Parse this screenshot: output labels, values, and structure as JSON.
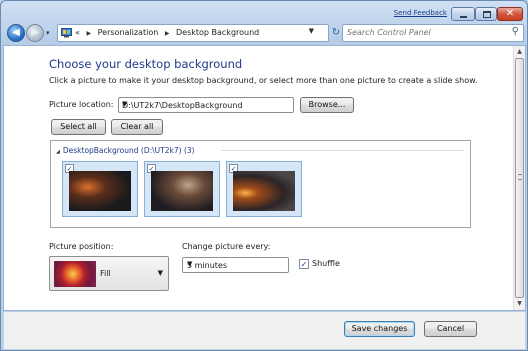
{
  "caption": {
    "send_feedback": "Send Feedback",
    "minimize_icon": "minimize-icon",
    "maximize_icon": "maximize-icon",
    "close_icon": "close-icon",
    "close_glyph": "✕"
  },
  "nav": {
    "back_glyph": "◀",
    "forward_glyph": "▶",
    "address": {
      "prefix": "«",
      "crumbs": [
        "Personalization",
        "Desktop Background"
      ],
      "separator": "▶"
    },
    "search_placeholder": "Search Control Panel"
  },
  "main": {
    "title": "Choose your desktop background",
    "subtitle": "Click a picture to make it your desktop background, or select more than one picture to create a slide show.",
    "picture_location_label": "Picture location:",
    "picture_location_value": "D:\\UT2k7\\DesktopBackground",
    "browse_label": "Browse...",
    "select_all_label": "Select all",
    "clear_all_label": "Clear all",
    "gallery": {
      "group_title": "DesktopBackground (D:\\UT2k7) (3)",
      "items": [
        {
          "checked": true,
          "selected": true
        },
        {
          "checked": true,
          "selected": true
        },
        {
          "checked": true,
          "selected": true
        }
      ]
    },
    "picture_position_label": "Picture position:",
    "picture_position_value": "Fill",
    "change_every_label": "Change picture every:",
    "change_every_value": "5 minutes",
    "shuffle_label": "Shuffle",
    "shuffle_checked": true
  },
  "footer": {
    "save_label": "Save changes",
    "cancel_label": "Cancel"
  },
  "colors": {
    "title_blue": "#1e3a8a",
    "frame": "#b9d0ea",
    "tile_bg": "#d5e6f7"
  }
}
